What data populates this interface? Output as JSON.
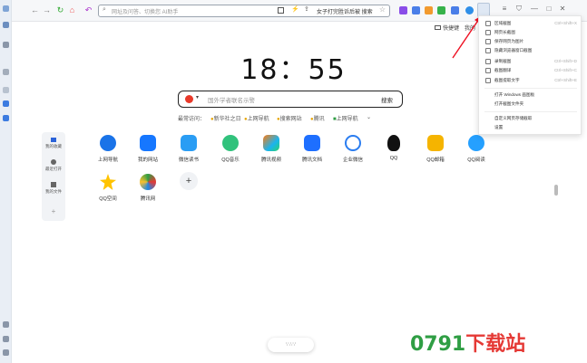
{
  "toolbar": {
    "address_placeholder": "网址及问答、切换您 AI助手",
    "news": "女子打完胜诉后被  搜索",
    "window_controls": [
      "≡",
      "⛉",
      "—",
      "□",
      "✕"
    ]
  },
  "quick_links": [
    "快捷键",
    "我的"
  ],
  "clock": "18：55",
  "search": {
    "placeholder": "国外学者联名示警",
    "button": "搜索"
  },
  "recent": {
    "label": "最常访问：",
    "items": [
      "新华社之日",
      "上网导航",
      "搜索网站",
      "腾讯",
      "上网导航"
    ]
  },
  "side_panel": [
    "我的收藏",
    "最近打开",
    "我的文件",
    "+"
  ],
  "apps": [
    {
      "label": "上网导航",
      "color": "#1a73e8",
      "icon": "navigation-icon"
    },
    {
      "label": "我的网站",
      "color": "#1677ff",
      "icon": "star-house-icon"
    },
    {
      "label": "微信读书",
      "color": "#2a9df4",
      "icon": "book-icon"
    },
    {
      "label": "QQ音乐",
      "color": "#31c27c",
      "icon": "music-icon"
    },
    {
      "label": "腾讯视频",
      "color": "#ff7a0f",
      "icon": "video-icon"
    },
    {
      "label": "腾讯文档",
      "color": "#1e6fff",
      "icon": "doc-icon"
    },
    {
      "label": "企业微信",
      "color": "#2b7df0",
      "icon": "chat-icon"
    },
    {
      "label": "QQ",
      "color": "#111111",
      "icon": "penguin-icon"
    },
    {
      "label": "QQ邮箱",
      "color": "#f5b400",
      "icon": "mail-icon"
    },
    {
      "label": "QQ阅读",
      "color": "#25a0ff",
      "icon": "reader-icon"
    },
    {
      "label": "QQ空间",
      "color": "#ffc300",
      "icon": "star-icon"
    },
    {
      "label": "腾讯网",
      "color": "#2f9e44",
      "icon": "globe-icon"
    }
  ],
  "add_label": "+",
  "menu": {
    "items": [
      {
        "label": "区域截图",
        "shortcut": "Ctrl+Shift+X"
      },
      {
        "label": "网页长截图",
        "shortcut": ""
      },
      {
        "label": "保存网页为图片",
        "shortcut": ""
      },
      {
        "label": "隐藏浏览器窗口截图",
        "shortcut": ""
      },
      {
        "label": "录制截图",
        "shortcut": "Ctrl+Shift+D"
      },
      {
        "label": "截图翻译",
        "shortcut": "Ctrl+Shift+C"
      },
      {
        "label": "截图提取文字",
        "shortcut": "Ctrl+Shift+E"
      },
      {
        "label": "打开 Windows 画图板",
        "shortcut": ""
      },
      {
        "label": "打开截图文件夹",
        "shortcut": ""
      },
      {
        "label": "自定义网页存储截取",
        "shortcut": ""
      },
      {
        "label": "设置",
        "shortcut": ""
      }
    ]
  },
  "bottom_pill": "∵∴∵",
  "watermark": {
    "number": "0791",
    "text": "下载站"
  }
}
